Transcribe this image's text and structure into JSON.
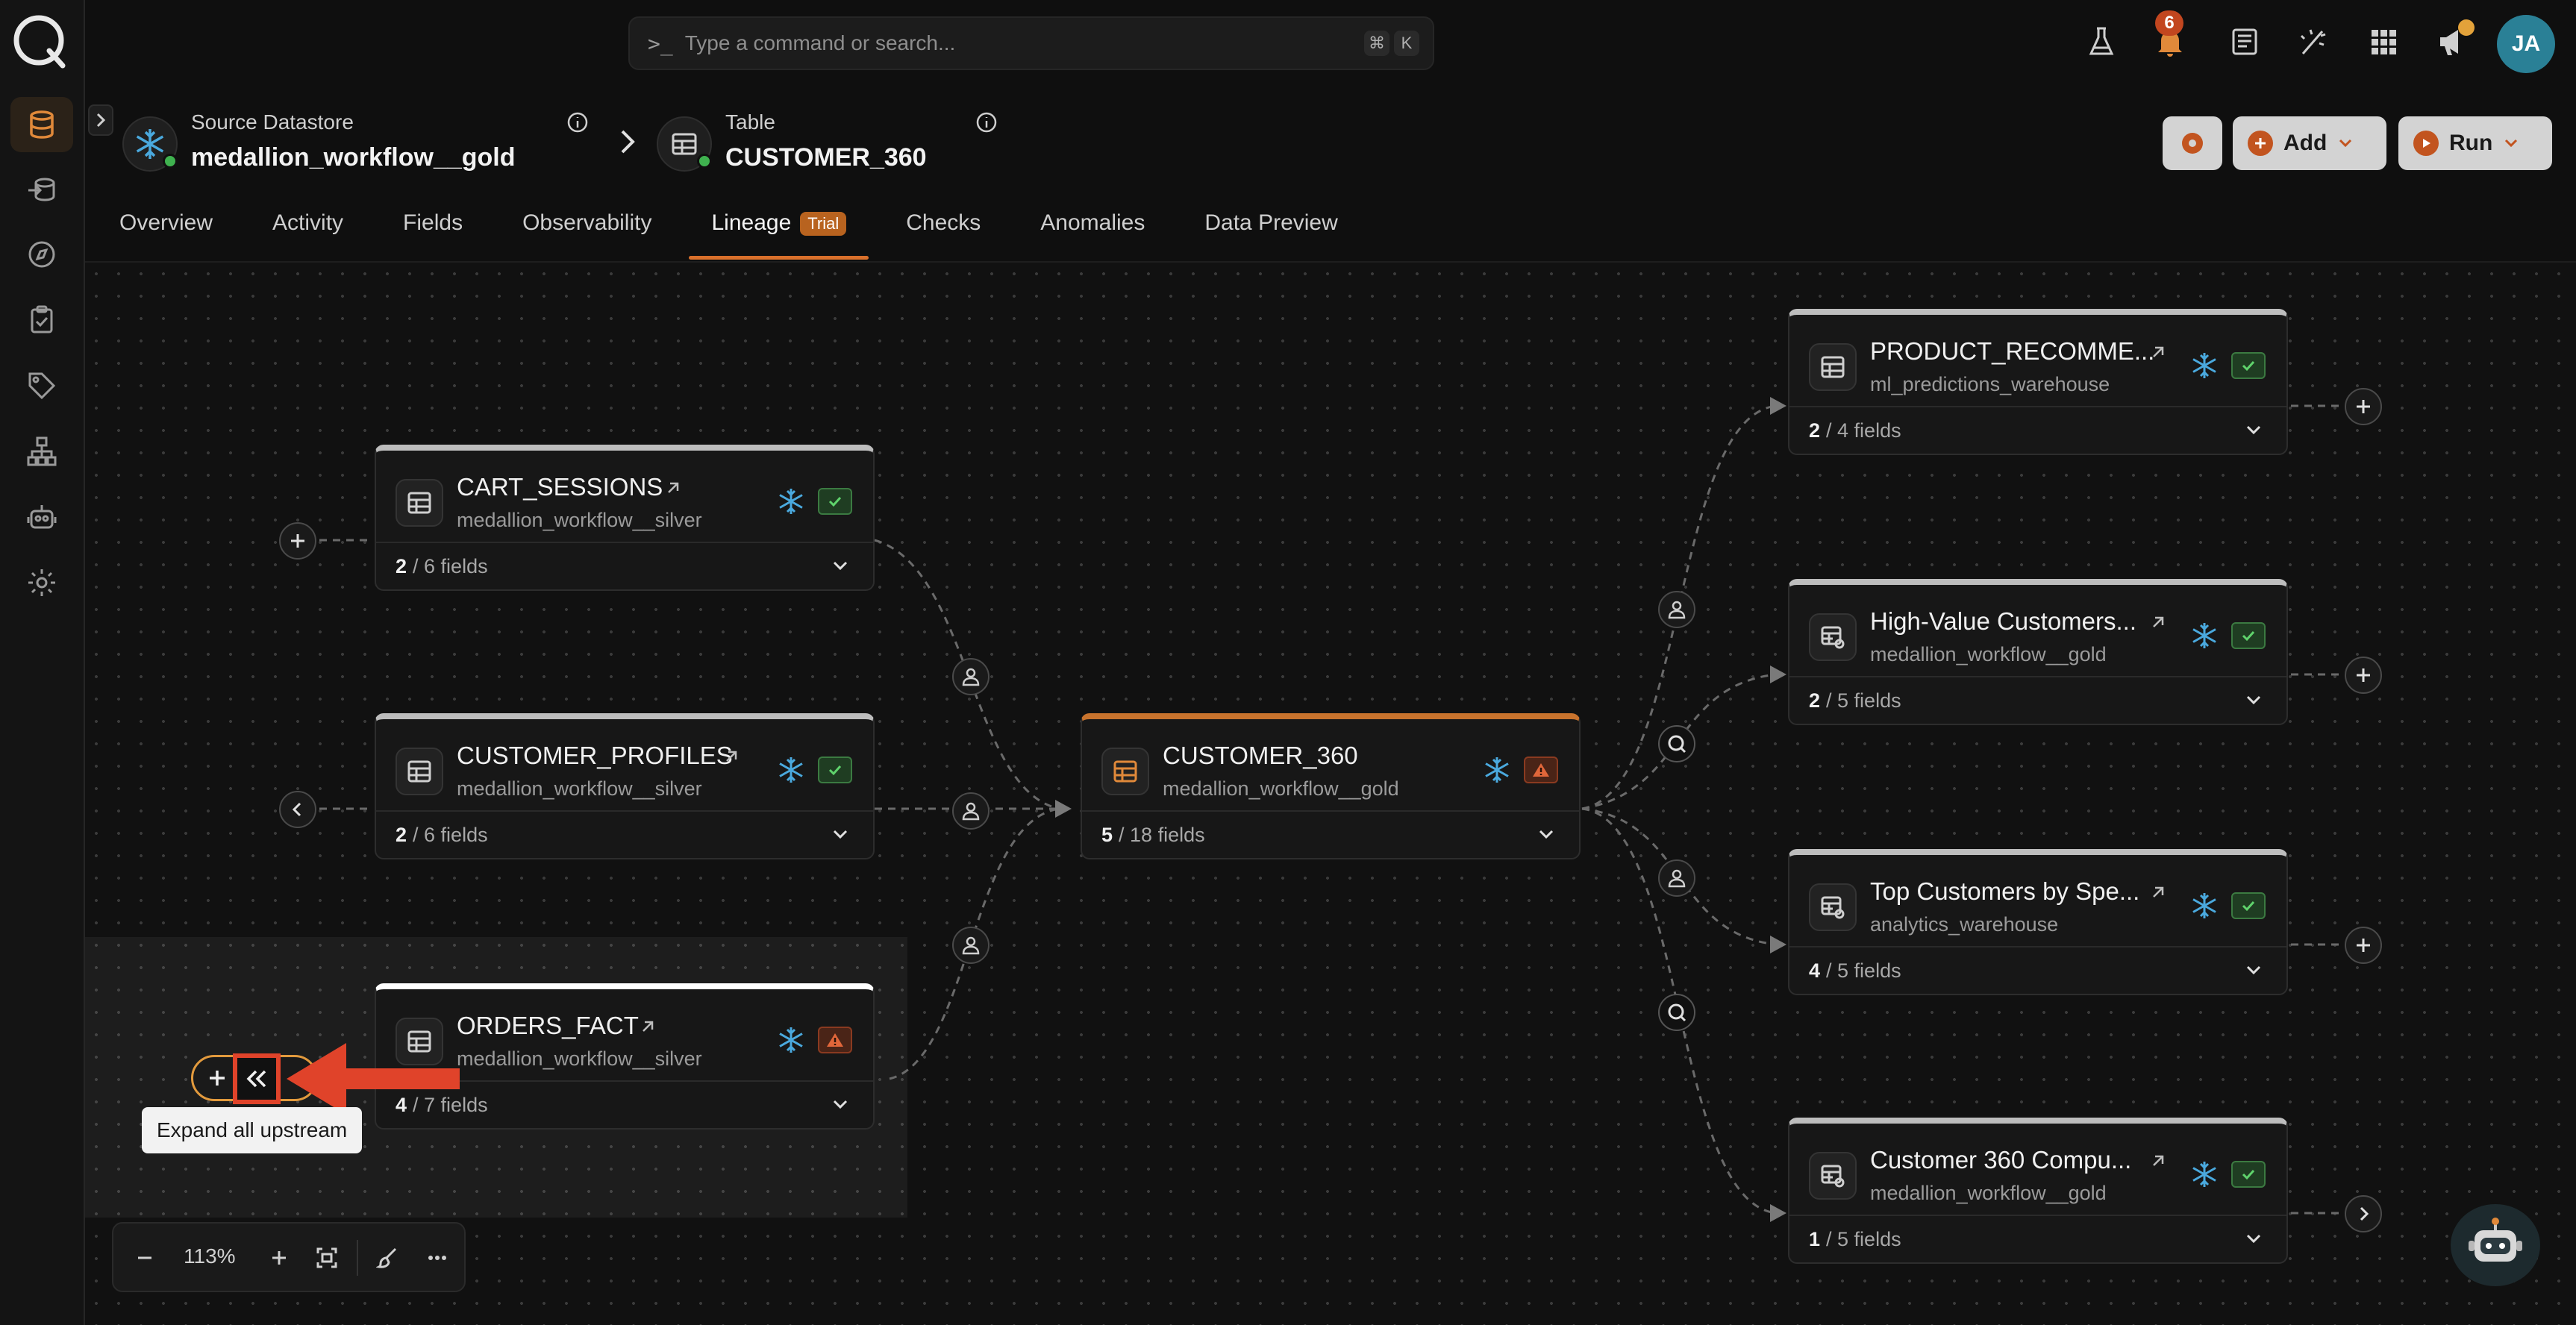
{
  "search": {
    "placeholder": "Type a command or search...",
    "shortcut_mod": "⌘",
    "shortcut_key": "K"
  },
  "notifications": {
    "count": "6"
  },
  "user": {
    "initials": "JA"
  },
  "header": {
    "source_label": "Source Datastore",
    "source_value": "medallion_workflow__gold",
    "table_label": "Table",
    "table_value": "CUSTOMER_360"
  },
  "actions": {
    "add_label": "Add",
    "run_label": "Run"
  },
  "tabs": [
    {
      "label": "Overview"
    },
    {
      "label": "Activity"
    },
    {
      "label": "Fields"
    },
    {
      "label": "Observability"
    },
    {
      "label": "Lineage",
      "badge": "Trial",
      "active": true
    },
    {
      "label": "Checks"
    },
    {
      "label": "Anomalies"
    },
    {
      "label": "Data Preview"
    }
  ],
  "nodes": {
    "cart_sessions": {
      "title": "CART_SESSIONS",
      "datastore": "medallion_workflow__silver",
      "fields_shown": "2",
      "fields_total": "/ 6 fields",
      "status": "ok"
    },
    "customer_profiles": {
      "title": "CUSTOMER_PROFILES",
      "datastore": "medallion_workflow__silver",
      "fields_shown": "2",
      "fields_total": "/ 6 fields",
      "status": "ok"
    },
    "orders_fact": {
      "title": "ORDERS_FACT",
      "datastore": "medallion_workflow__silver",
      "fields_shown": "4",
      "fields_total": "/ 7 fields",
      "status": "warn"
    },
    "customer_360": {
      "title": "CUSTOMER_360",
      "datastore": "medallion_workflow__gold",
      "fields_shown": "5",
      "fields_total": "/ 18 fields",
      "status": "warn"
    },
    "product_recomme": {
      "title": "PRODUCT_RECOMME...",
      "datastore": "ml_predictions_warehouse",
      "fields_shown": "2",
      "fields_total": "/ 4 fields",
      "status": "ok"
    },
    "high_value": {
      "title": "High-Value Customers...",
      "datastore": "medallion_workflow__gold",
      "fields_shown": "2",
      "fields_total": "/ 5 fields",
      "status": "ok"
    },
    "top_customers": {
      "title": "Top Customers by Spe...",
      "datastore": "analytics_warehouse",
      "fields_shown": "4",
      "fields_total": "/ 5 fields",
      "status": "ok"
    },
    "customer_360_compu": {
      "title": "Customer 360 Compu...",
      "datastore": "medallion_workflow__gold",
      "fields_shown": "1",
      "fields_total": "/ 5 fields",
      "status": "ok"
    }
  },
  "tooltip": {
    "text": "Expand all upstream"
  },
  "zoom": {
    "value": "113%"
  },
  "colors": {
    "accent": "#d9702b",
    "ok": "#3fb24f",
    "warn": "#c2461f",
    "snowflake": "#4aa9de"
  }
}
